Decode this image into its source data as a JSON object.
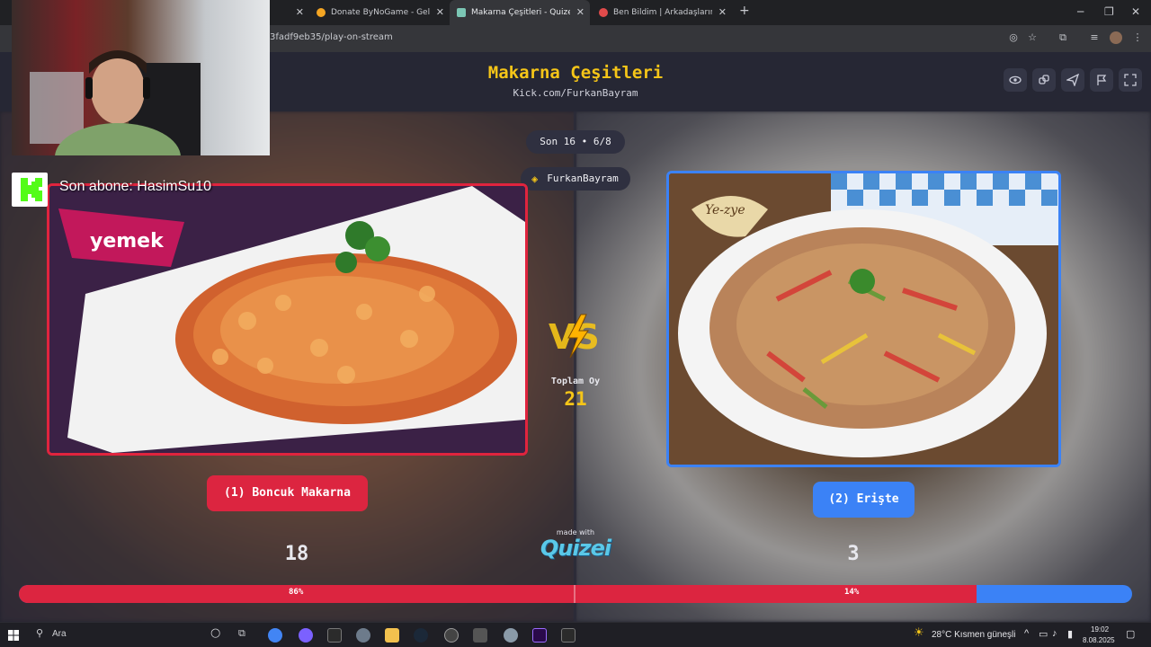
{
  "browser": {
    "tabs": [
      {
        "label": "Donate ByNoGame - Gelen/Gi…",
        "active": false
      },
      {
        "label": "Makarna Çeşitleri - Quizei",
        "active": true
      },
      {
        "label": "Ben Bildim | Arkadaşlarınla Onli…",
        "active": false
      }
    ],
    "url": "3fadf9eb35/play-on-stream"
  },
  "header": {
    "title": "Makarna Çeşitleri",
    "subtitle": "Kick.com/FurkanBayram"
  },
  "round": "Son 16 • 6/8",
  "streamer": "FurkanBayram",
  "overlay": {
    "subscriber": "Son abone: HasimSu10"
  },
  "center": {
    "total_label": "Toplam Oy",
    "total_votes": "21",
    "made_with": "made with",
    "brand": "Quizei"
  },
  "options": [
    {
      "label": "(1) Boncuk Makarna",
      "votes": "18",
      "percent_label": "86%",
      "share": 0.86,
      "color": "#dc2540"
    },
    {
      "label": "(2) Erişte",
      "votes": "3",
      "percent_label": "14%",
      "share": 0.14,
      "color": "#3b82f6"
    }
  ],
  "taskbar": {
    "search": "Ara",
    "weather": "28°C  Kısmen güneşli",
    "time": "19:02",
    "date": "8.08.2025"
  }
}
